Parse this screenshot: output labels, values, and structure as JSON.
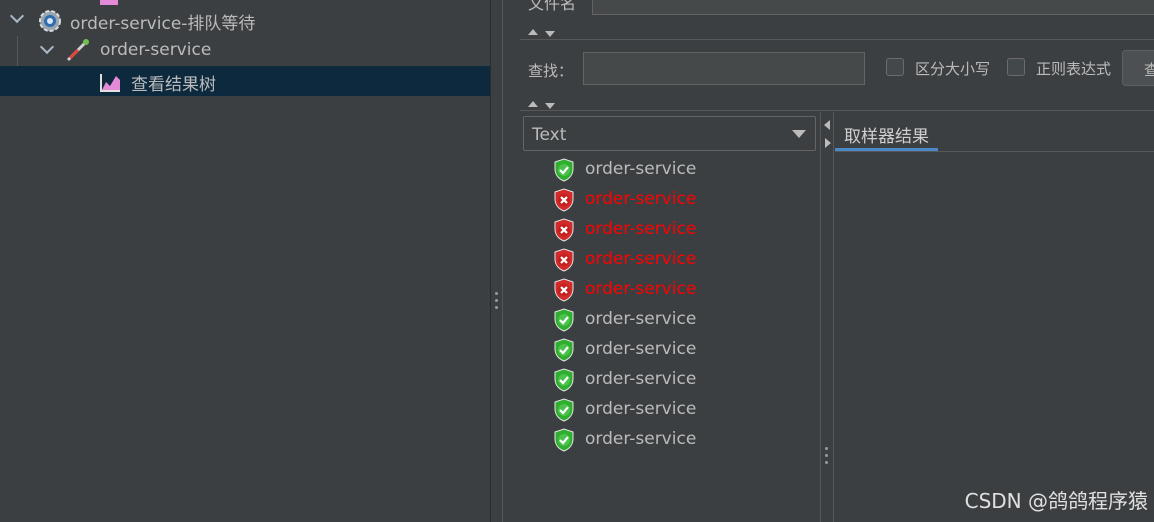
{
  "tree": {
    "thread_group_label": "order-service-排队等待",
    "sampler_label": "order-service",
    "listener_label": "查看结果树"
  },
  "top": {
    "filename_label": "文件名",
    "search_label": "查找：",
    "case_sensitive_label": "区分大小写",
    "regex_label": "正则表达式",
    "search_button_label": "查"
  },
  "renderer": {
    "selected": "Text"
  },
  "results": [
    {
      "label": "order-service",
      "status": "success"
    },
    {
      "label": "order-service",
      "status": "error"
    },
    {
      "label": "order-service",
      "status": "error"
    },
    {
      "label": "order-service",
      "status": "error"
    },
    {
      "label": "order-service",
      "status": "error"
    },
    {
      "label": "order-service",
      "status": "success"
    },
    {
      "label": "order-service",
      "status": "success"
    },
    {
      "label": "order-service",
      "status": "success"
    },
    {
      "label": "order-service",
      "status": "success"
    },
    {
      "label": "order-service",
      "status": "success"
    }
  ],
  "detail": {
    "tab_label": "取样器结果"
  },
  "watermark": "CSDN @鸽鸽程序猿",
  "colors": {
    "background": "#3c3f41",
    "selection": "#0d293e",
    "error_text": "#ff0000",
    "success_icon": "#2fae2f",
    "error_icon": "#d22a2a",
    "tab_underline": "#4a88c7"
  }
}
